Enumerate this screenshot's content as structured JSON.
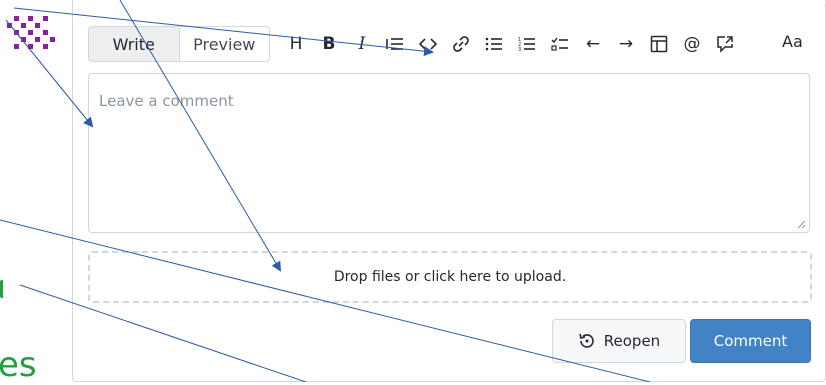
{
  "tabs": [
    {
      "label": "Write",
      "active": true
    },
    {
      "label": "Preview",
      "active": false
    }
  ],
  "toolbar": {
    "items": [
      {
        "name": "heading-icon",
        "glyph": "H"
      },
      {
        "name": "bold-icon",
        "glyph": "B"
      },
      {
        "name": "italic-icon",
        "glyph": "I"
      },
      {
        "name": "quote-icon",
        "glyph": "⁝≡"
      },
      {
        "name": "code-icon",
        "glyph": "<>"
      },
      {
        "name": "link-icon",
        "glyph": "🔗"
      },
      {
        "name": "bullet-list-icon",
        "glyph": "☰"
      },
      {
        "name": "numbered-list-icon",
        "glyph": "☷"
      },
      {
        "name": "task-list-icon",
        "glyph": "☑"
      },
      {
        "name": "arrow-left-icon",
        "glyph": "←"
      },
      {
        "name": "arrow-right-icon",
        "glyph": "→"
      },
      {
        "name": "table-icon",
        "glyph": "⊞"
      },
      {
        "name": "mention-icon",
        "glyph": "@"
      },
      {
        "name": "reference-icon",
        "glyph": "↗"
      }
    ],
    "font_toggle": "Aa"
  },
  "editor": {
    "placeholder": "Leave a comment"
  },
  "dropzone": {
    "text": "Drop files or click here to upload."
  },
  "actions": {
    "reopen_label": "Reopen",
    "comment_label": "Comment"
  },
  "sidebar": {
    "fragment_text": "es"
  },
  "colors": {
    "accent": "#4183c4",
    "border": "#d0d7de",
    "annotation_arrow": "#2a5ba8",
    "avatar": "#8b1fa3",
    "green_fragment": "#21a040"
  }
}
